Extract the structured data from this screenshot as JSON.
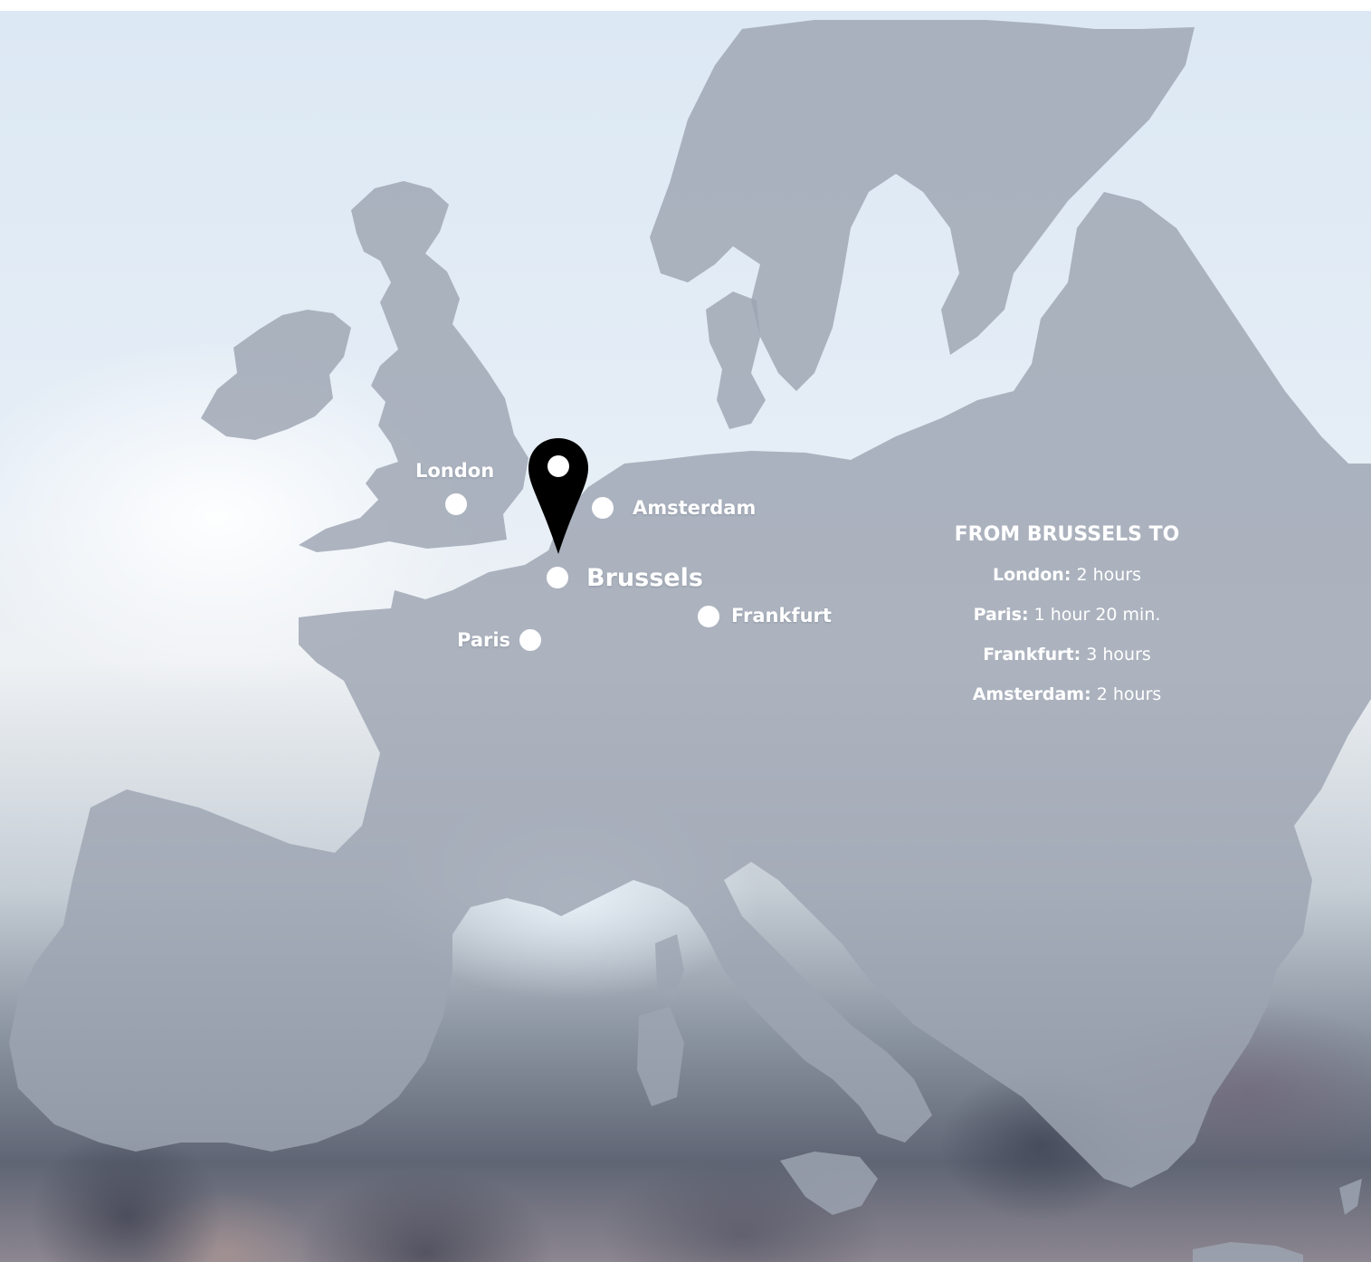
{
  "map": {
    "origin": {
      "name": "Brussels"
    },
    "cities": [
      {
        "id": "london",
        "name": "London"
      },
      {
        "id": "amsterdam",
        "name": "Amsterdam"
      },
      {
        "id": "brussels",
        "name": "Brussels"
      },
      {
        "id": "frankfurt",
        "name": "Frankfurt"
      },
      {
        "id": "paris",
        "name": "Paris"
      }
    ],
    "marker_icon": "location-pin-icon",
    "colors": {
      "land": "#9ea5b2",
      "dots": "#ffffff",
      "pin": "#000000",
      "text": "#ffffff"
    }
  },
  "panel": {
    "title": "FROM BRUSSELS TO",
    "routes": [
      {
        "city": "London:",
        "time": "2 hours"
      },
      {
        "city": "Paris:",
        "time": "1 hour 20 min."
      },
      {
        "city": "Frankfurt:",
        "time": "3 hours"
      },
      {
        "city": "Amsterdam:",
        "time": "2 hours"
      }
    ]
  }
}
